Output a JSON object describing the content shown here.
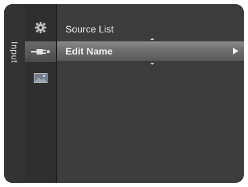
{
  "sidebar": {
    "tab_label": "Input",
    "icons": [
      {
        "name": "setup-gear-icon",
        "active": false
      },
      {
        "name": "input-plug-icon",
        "active": true
      },
      {
        "name": "picture-icon",
        "active": false
      }
    ]
  },
  "menu": {
    "items": [
      {
        "label": "Source List",
        "selected": false
      },
      {
        "label": "Edit Name",
        "selected": true
      }
    ]
  },
  "colors": {
    "background": "#3c3c3c",
    "highlight": "#7a7a7a",
    "text": "#f2f2f2"
  }
}
